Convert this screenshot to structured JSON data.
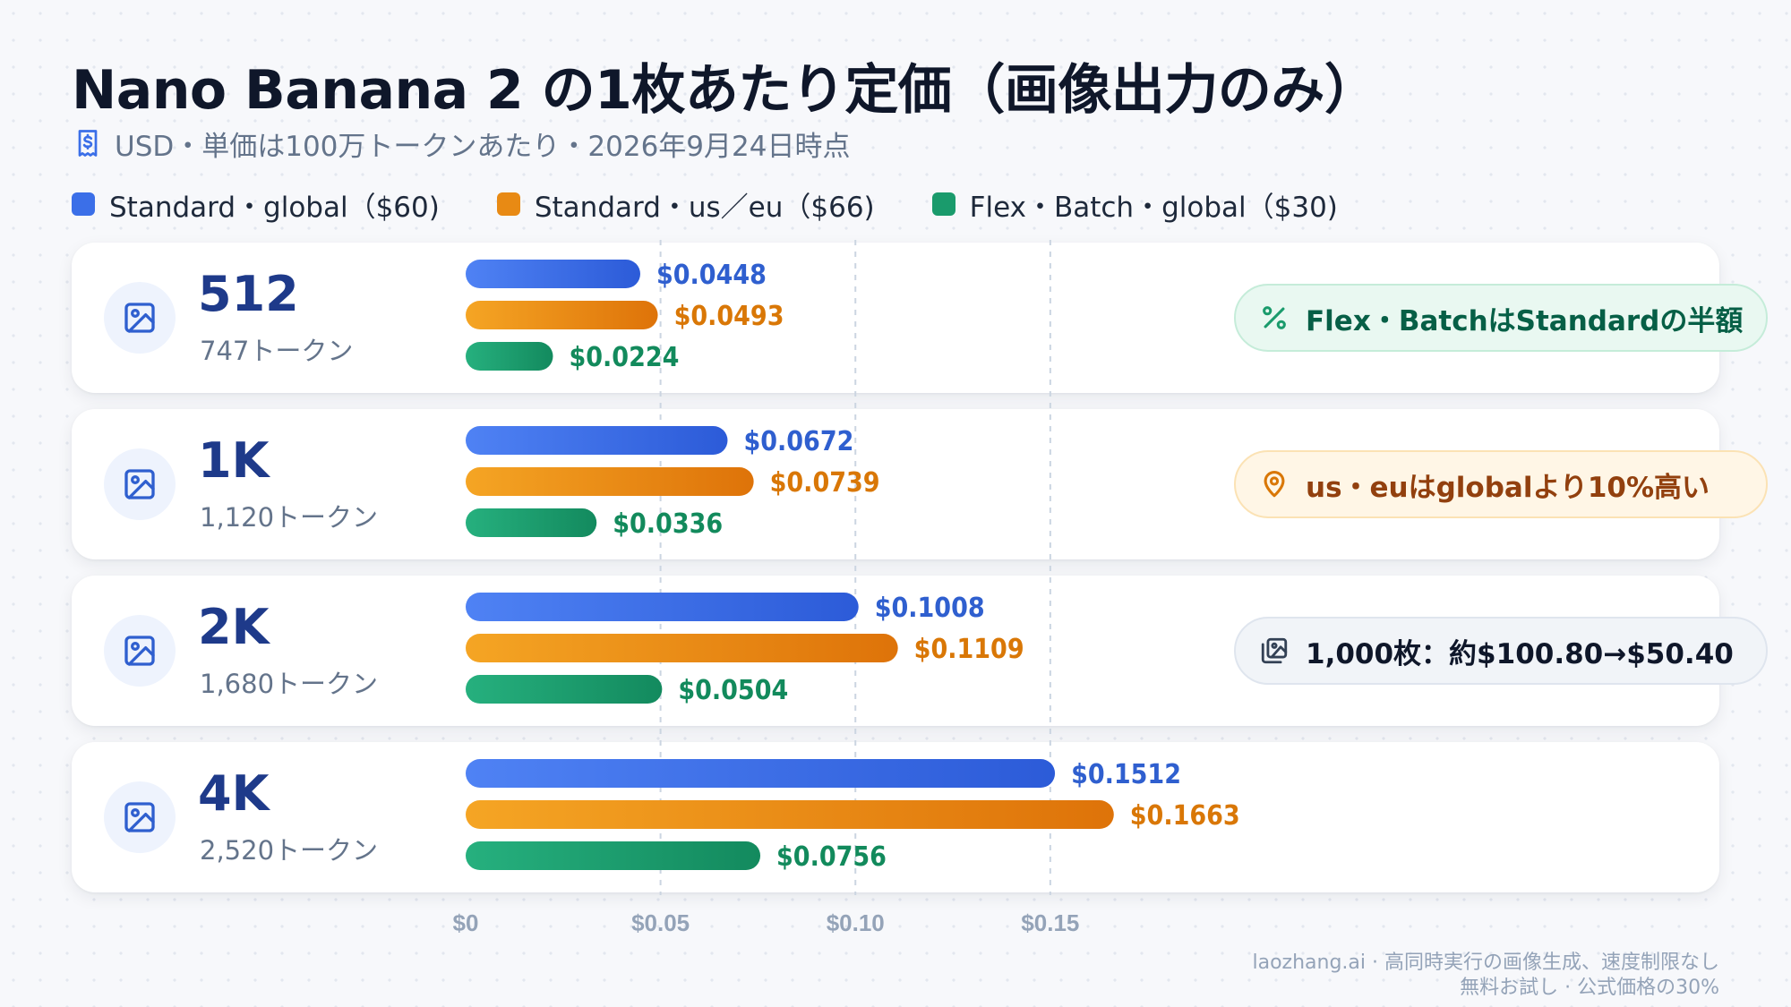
{
  "title": "Nano Banana 2 の1枚あたり定価（画像出力のみ）",
  "subtitle": "USD・単価は100万トークンあたり・2026年9月24日時点",
  "legend": [
    {
      "label": "Standard・global（$60)",
      "color": "#3b6fe8"
    },
    {
      "label": "Standard・us／eu（$66)",
      "color": "#e88a14"
    },
    {
      "label": "Flex・Batch・global（$30)",
      "color": "#1a9b6c"
    }
  ],
  "rows": [
    {
      "resolution": "512",
      "tokens": "747トークン",
      "pill": {
        "text": "Flex・BatchはStandardの半額",
        "icon": "percent-icon",
        "style": "green"
      }
    },
    {
      "resolution": "1K",
      "tokens": "1,120トークン",
      "pill": {
        "text": "us・euはglobalより10%高い",
        "icon": "map-pin-icon",
        "style": "amber"
      }
    },
    {
      "resolution": "2K",
      "tokens": "1,680トークン",
      "pill": {
        "text": "1,000枚：約$100.80→$50.40",
        "icon": "images-icon",
        "style": "gray"
      }
    },
    {
      "resolution": "4K",
      "tokens": "2,520トークン",
      "pill": null
    }
  ],
  "chart_data": {
    "type": "bar",
    "orientation": "horizontal",
    "categories": [
      "512",
      "1K",
      "2K",
      "4K"
    ],
    "series": [
      {
        "name": "Standard・global（$60)",
        "color": "#3b6fe8",
        "values": [
          0.0448,
          0.0672,
          0.1008,
          0.1512
        ],
        "labels": [
          "$0.0448",
          "$0.0672",
          "$0.1008",
          "$0.1512"
        ]
      },
      {
        "name": "Standard・us／eu（$66)",
        "color": "#e88a14",
        "values": [
          0.0493,
          0.0739,
          0.1109,
          0.1663
        ],
        "labels": [
          "$0.0493",
          "$0.0739",
          "$0.1109",
          "$0.1663"
        ]
      },
      {
        "name": "Flex・Batch・global（$30)",
        "color": "#1a9b6c",
        "values": [
          0.0224,
          0.0336,
          0.0504,
          0.0756
        ],
        "labels": [
          "$0.0224",
          "$0.0336",
          "$0.0504",
          "$0.0756"
        ]
      }
    ],
    "xlim": [
      0,
      0.193
    ],
    "xticks": [
      0,
      0.05,
      0.1,
      0.15
    ],
    "xtick_labels": [
      "$0",
      "$0.05",
      "$0.10",
      "$0.15"
    ],
    "grid": true
  },
  "footer": {
    "line1": "laozhang.ai · 高同時実行の画像生成、速度制限なし",
    "line2": "無料お試し · 公式価格の30%"
  }
}
